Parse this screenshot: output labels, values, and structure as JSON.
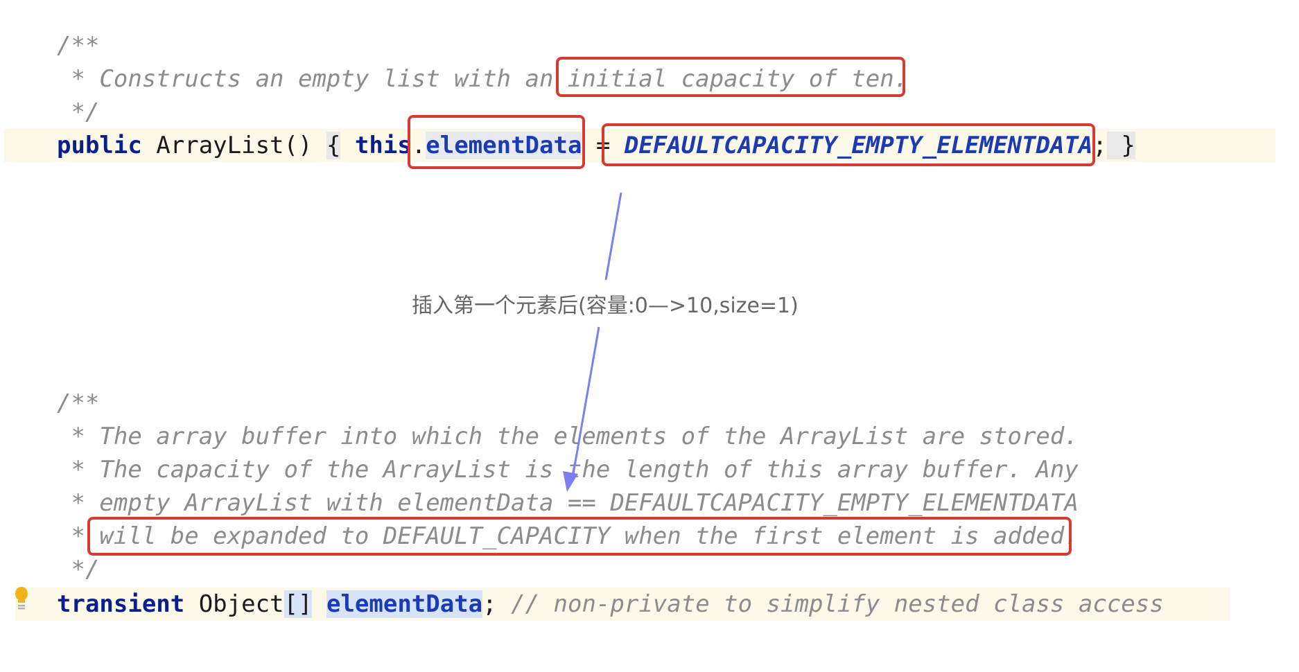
{
  "block1": {
    "comment_open": "/**",
    "comment_line": " * Constructs an empty list with an initial capacity of ten.",
    "comment_close": " */",
    "code": {
      "keyword_public": "public",
      "ctor": " ArrayList() ",
      "brace_open": "{",
      "keyword_this": " this",
      "dot": ".",
      "field": "elementData",
      "assign": " = ",
      "constant": "DEFAULTCAPACITY_EMPTY_ELEMENTDATA",
      "semicolon": ";",
      "brace_close": " }"
    }
  },
  "annotation": {
    "text": "插入第一个元素后(容量:0—>10,size=1)",
    "arrow_color": "#7b7ff0"
  },
  "block2": {
    "comment_open": "/**",
    "lines": [
      " * The array buffer into which the elements of the ArrayList are stored.",
      " * The capacity of the ArrayList is the length of this array buffer. Any",
      " * empty ArrayList with elementData == DEFAULTCAPACITY_EMPTY_ELEMENTDATA",
      " * will be expanded to DEFAULT_CAPACITY when the first element is added."
    ],
    "comment_close": " */",
    "code": {
      "keyword_transient": "transient",
      "type": " Object",
      "brackets": "[]",
      "space": " ",
      "field": "elementData",
      "semicolon": ";",
      "comment": " // non-private to simplify nested class access"
    }
  },
  "colors": {
    "highlight_box": "#d93a30",
    "line_highlight": "#fcf9e8",
    "keyword": "#0a1f8f",
    "field": "#1b3bb5",
    "comment": "#8c8c8c",
    "bulb": "#f2b21b"
  },
  "icons": {
    "gutter": "lightbulb-icon"
  }
}
